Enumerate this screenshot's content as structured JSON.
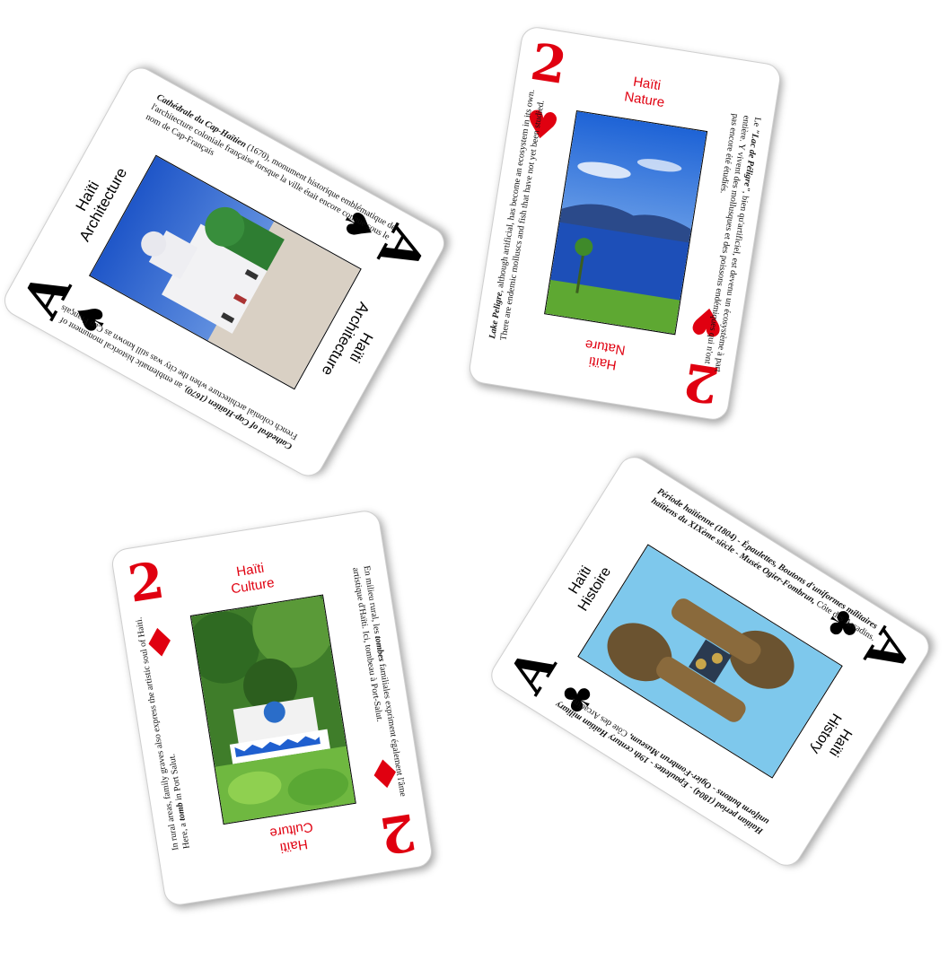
{
  "cards": [
    {
      "id": "ace-spades",
      "rank": "A",
      "suit_icon": "spade-icon",
      "suit_glyph": "♠",
      "color": "#000000",
      "label_line1": "Haïti",
      "label_line2": "Architecture",
      "desc_fr_title": "Cathédrale du Cap-Haïtien",
      "desc_fr_text": " (1670), monument historique emblématique de l'architecture coloniale française lorsque la ville était encore connue sous le nom de Cap-Français",
      "desc_en_title": "Cathedral of Cap-Haïtien (1670)",
      "desc_en_text": ", an emblematic historical monument of French colonial architecture when the city was still known as Cap Français"
    },
    {
      "id": "two-hearts",
      "rank": "2",
      "suit_icon": "heart-icon",
      "suit_glyph": "♥",
      "color": "#e00010",
      "label_line1": "Haïti",
      "label_line2": "Nature",
      "desc_fr_prefix": "Le ",
      "desc_fr_title": "\"Lac de Péligre\"",
      "desc_fr_text": ", bien qu'artificiel, est devenu un écosystème à part entière. Y vivent des mollusques et des poissons endémiques qui n'ont pas encore été étudiés.",
      "desc_en_title": "Lake Peligre",
      "desc_en_text": ", although artificial, has become an ecosystem in its own. There are endemic molluscs and fish that have not yet been studied."
    },
    {
      "id": "two-diamonds",
      "rank": "2",
      "suit_icon": "diamond-icon",
      "suit_glyph": "♦",
      "color": "#e00010",
      "label_line1": "Haïti",
      "label_line2": "Culture",
      "desc_fr_prefix": "En milieu rural, les ",
      "desc_fr_title": "tombes",
      "desc_fr_text": " familiales expriment également l'âme artistique d'Haïti. Ici, tombeau à Port-Salut.",
      "desc_en_prefix": "In rural areas, family graves also express the artistic soul of Haiti. Here, a ",
      "desc_en_title": "tomb",
      "desc_en_text": " in Port Salut."
    },
    {
      "id": "ace-clubs",
      "rank": "A",
      "suit_icon": "club-icon",
      "suit_glyph": "♣",
      "color": "#000000",
      "label_fr_line1": "Haïti",
      "label_fr_line2": "Histoire",
      "label_en_line1": "Haïti",
      "label_en_line2": "History",
      "desc_fr_title": "Période haïtienne (1804) - Épaulettes, Boutons d'uniformes militaires haïtiens du XIXème siècle - Musée Ogier-Fombrun,",
      "desc_fr_text": " Côte des Arcadins.",
      "desc_en_title": "Haitian period (1804) - Epaulettes - 19th century Haitian military uniform buttons - Ogier-Fombrun Museum,",
      "desc_en_text": " Côte des Arcadins."
    }
  ]
}
